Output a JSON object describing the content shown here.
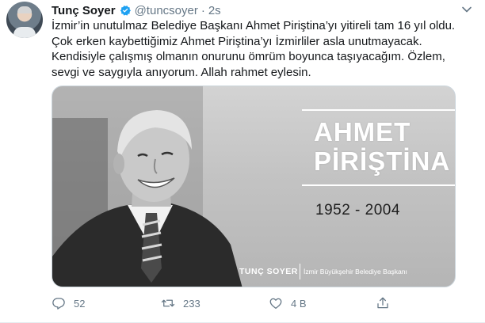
{
  "author": {
    "display_name": "Tunç Soyer",
    "handle": "@tuncsoyer",
    "separator": "·",
    "time": "2s",
    "verified_icon": "verified-badge-icon",
    "verified_color": "#1da1f2"
  },
  "tweet": {
    "lines": [
      "İzmir’in unutulmaz Belediye Başkanı Ahmet Piriştina’yı yitireli tam 16 yıl oldu.",
      "Çok erken kaybettiğimiz Ahmet Piriştina’yı İzmirliler asla unutmayacak.",
      "Kendisiyle çalışmış olmanın onurunu ömrüm boyunca taşıyacağım. Özlem,",
      "sevgi ve saygıyla anıyorum. Allah rahmet eylesin."
    ]
  },
  "media": {
    "name_first": "AHMET",
    "name_last": "PİRİŞTİNA",
    "years": "1952 - 2004",
    "signature_name": "TUNÇ SOYER",
    "signature_title": "İzmir Büyükşehir Belediye Başkanı"
  },
  "actions": {
    "reply_count": "52",
    "retweet_count": "233",
    "like_count": "4 B",
    "reply_icon": "reply-icon",
    "retweet_icon": "retweet-icon",
    "like_icon": "heart-icon",
    "share_icon": "share-icon",
    "icon_color": "#657786"
  }
}
